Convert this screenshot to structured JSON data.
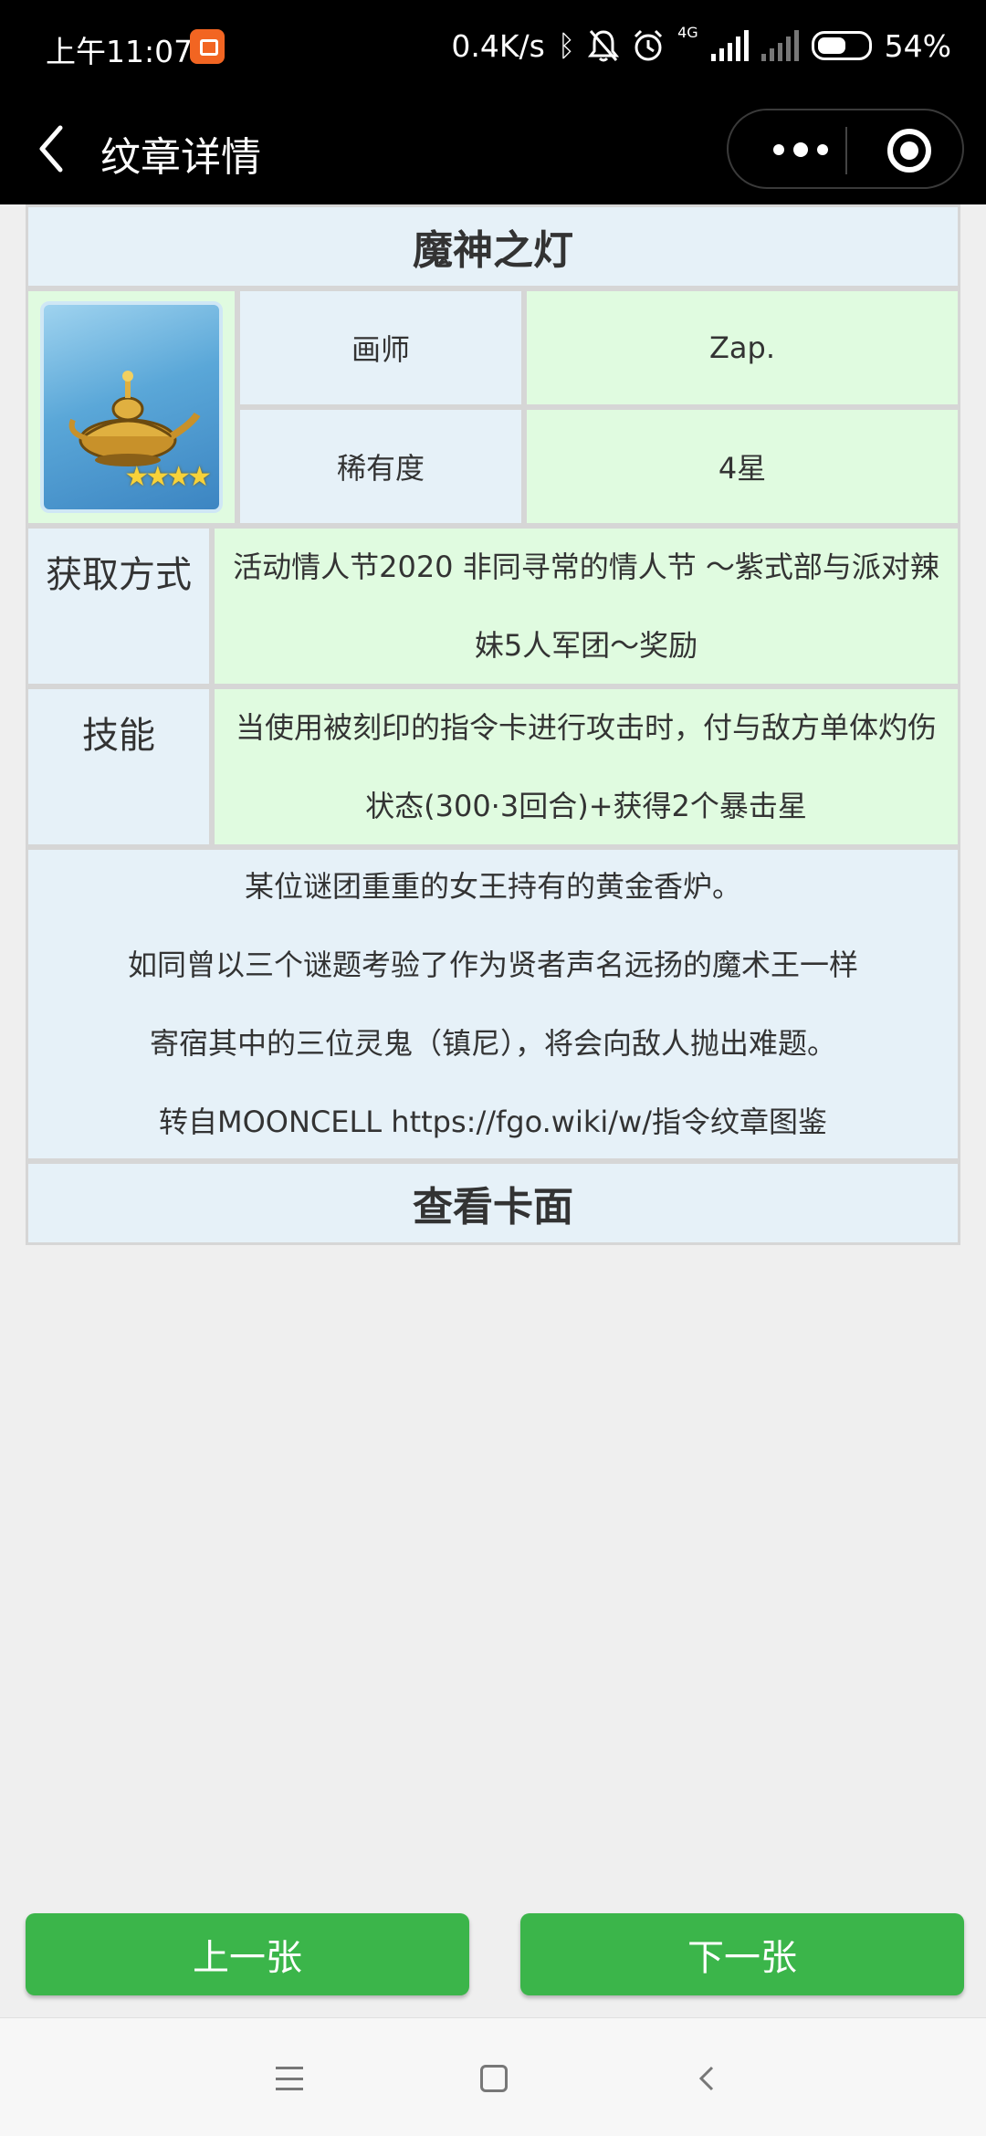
{
  "status_bar": {
    "time": "上午11:07",
    "speed": "0.4K/s",
    "network": "4G",
    "battery": "54%"
  },
  "nav": {
    "title": "纹章详情"
  },
  "card": {
    "name": "魔神之灯",
    "stars_glyph": "★★★★",
    "artist_label": "画师",
    "artist_value": "Zap.",
    "rarity_label": "稀有度",
    "rarity_value": "4星",
    "obtain_label": "获取方式",
    "obtain_value": "活动情人节2020 非同寻常的情人节 ～紫式部与派对辣妹5人军团～奖励",
    "skill_label": "技能",
    "skill_value": "当使用被刻印的指令卡进行攻击时，付与敌方单体灼伤状态(300·3回合)+获得2个暴击星",
    "desc_lines": [
      "某位谜团重重的女王持有的黄金香炉。",
      "如同曾以三个谜题考验了作为贤者声名远扬的魔术王一样",
      "寄宿其中的三位灵鬼（镇尼），将会向敌人抛出难题。",
      "转自MOONCELL https://fgo.wiki/w/指令纹章图鉴"
    ],
    "view_card_label": "查看卡面"
  },
  "buttons": {
    "prev": "上一张",
    "next": "下一张"
  },
  "colors": {
    "header_bg": "#000000",
    "cell_blue": "#e6f1f8",
    "cell_green": "#e0fbe0",
    "button_green": "#3bb54a"
  }
}
